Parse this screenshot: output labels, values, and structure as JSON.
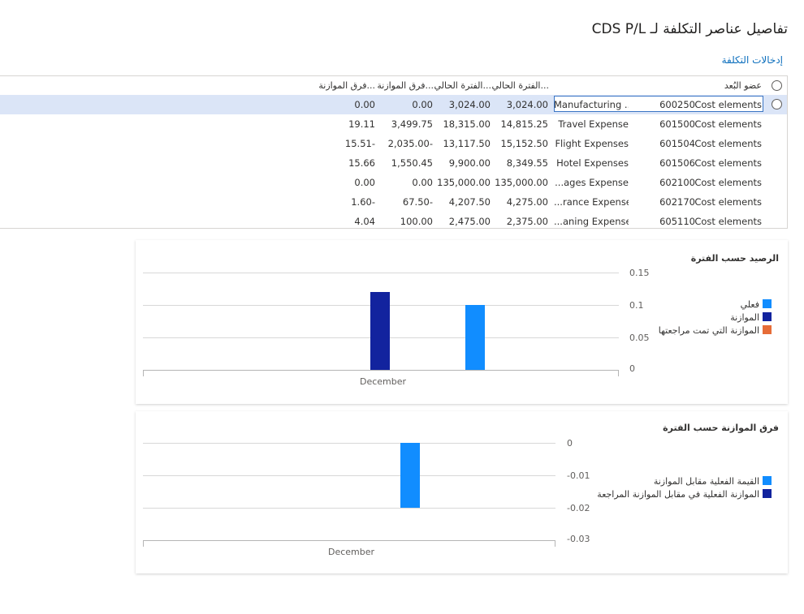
{
  "page": {
    "title": "تفاصيل عناصر التكلفة لـ CDS P/L",
    "tab_link": "إدخالات التكلفة"
  },
  "grid": {
    "headers": {
      "member": "عضو البُعد",
      "current_1": "الفترة الحالي...",
      "current_2": "الفترة الحالي...",
      "variance_1": "فرق الموازنة...",
      "variance_2": "فرق الموازنة..."
    },
    "rows": [
      {
        "type": "Cost elements",
        "code": "600250",
        "name": "Manufacturing ...",
        "c1": "3,024.00",
        "c2": "3,024.00",
        "v1": "0.00",
        "v2": "0.00"
      },
      {
        "type": "Cost elements",
        "code": "601500",
        "name": "Travel Expense",
        "c1": "14,815.25",
        "c2": "18,315.00",
        "v1": "3,499.75",
        "v2": "19.11"
      },
      {
        "type": "Cost elements",
        "code": "601504",
        "name": "Flight Expenses",
        "c1": "15,152.50",
        "c2": "13,117.50",
        "v1": "2,035.00-",
        "v2": "15.51-"
      },
      {
        "type": "Cost elements",
        "code": "601506",
        "name": "Hotel Expenses",
        "c1": "8,349.55",
        "c2": "9,900.00",
        "v1": "1,550.45",
        "v2": "15.66"
      },
      {
        "type": "Cost elements",
        "code": "602100",
        "name": "...ages Expense",
        "c1": "135,000.00",
        "c2": "135,000.00",
        "v1": "0.00",
        "v2": "0.00"
      },
      {
        "type": "Cost elements",
        "code": "602170",
        "name": "...rance Expense",
        "c1": "4,275.00",
        "c2": "4,207.50",
        "v1": "67.50-",
        "v2": "1.60-"
      },
      {
        "type": "Cost elements",
        "code": "605110",
        "name": "...aning Expense",
        "c1": "2,375.00",
        "c2": "2,475.00",
        "v1": "100.00",
        "v2": "4.04"
      }
    ]
  },
  "chart_data": [
    {
      "type": "bar",
      "title": "الرصيد حسب الفترة",
      "categories": [
        "December"
      ],
      "ylim": [
        0,
        0.15
      ],
      "yticks": [
        "0.15",
        "0.1",
        "0.05",
        "0"
      ],
      "series": [
        {
          "name": "فعلي",
          "values": [
            0.1
          ],
          "color": "#118dff"
        },
        {
          "name": "الموازنة",
          "values": [
            0.12
          ],
          "color": "#12239e"
        },
        {
          "name": "الموازنة التي تمت مراجعتها",
          "values": [
            0
          ],
          "color": "#e66c37"
        }
      ],
      "legend": "right",
      "grid": true
    },
    {
      "type": "bar",
      "title": "فرق الموازنة حسب الفترة",
      "categories": [
        "December"
      ],
      "ylim": [
        -0.03,
        0
      ],
      "yticks": [
        "0",
        "-0.01",
        "-0.02",
        "-0.03"
      ],
      "series": [
        {
          "name": "القيمة الفعلية مقابل الموازنة",
          "values": [
            -0.02
          ],
          "color": "#118dff"
        },
        {
          "name": "الموازنة الفعلية في مقابل الموازنة المراجعة",
          "values": [
            0
          ],
          "color": "#12239e"
        }
      ],
      "legend": "right",
      "grid": true
    }
  ],
  "chart_text": {
    "c1": {
      "title": "الرصيد حسب الفترة",
      "t0": "0.15",
      "t1": "0.1",
      "t2": "0.05",
      "t3": "0",
      "x": "December",
      "l0": "فعلي",
      "l1": "الموازنة",
      "l2": "الموازنة التي تمت مراجعتها"
    },
    "c2": {
      "title": "فرق الموازنة حسب الفترة",
      "t0": "0",
      "t1": "-0.01",
      "t2": "-0.02",
      "t3": "-0.03",
      "x": "December",
      "l0": "القيمة الفعلية مقابل الموازنة",
      "l1": "الموازنة الفعلية في مقابل الموازنة المراجعة"
    }
  }
}
